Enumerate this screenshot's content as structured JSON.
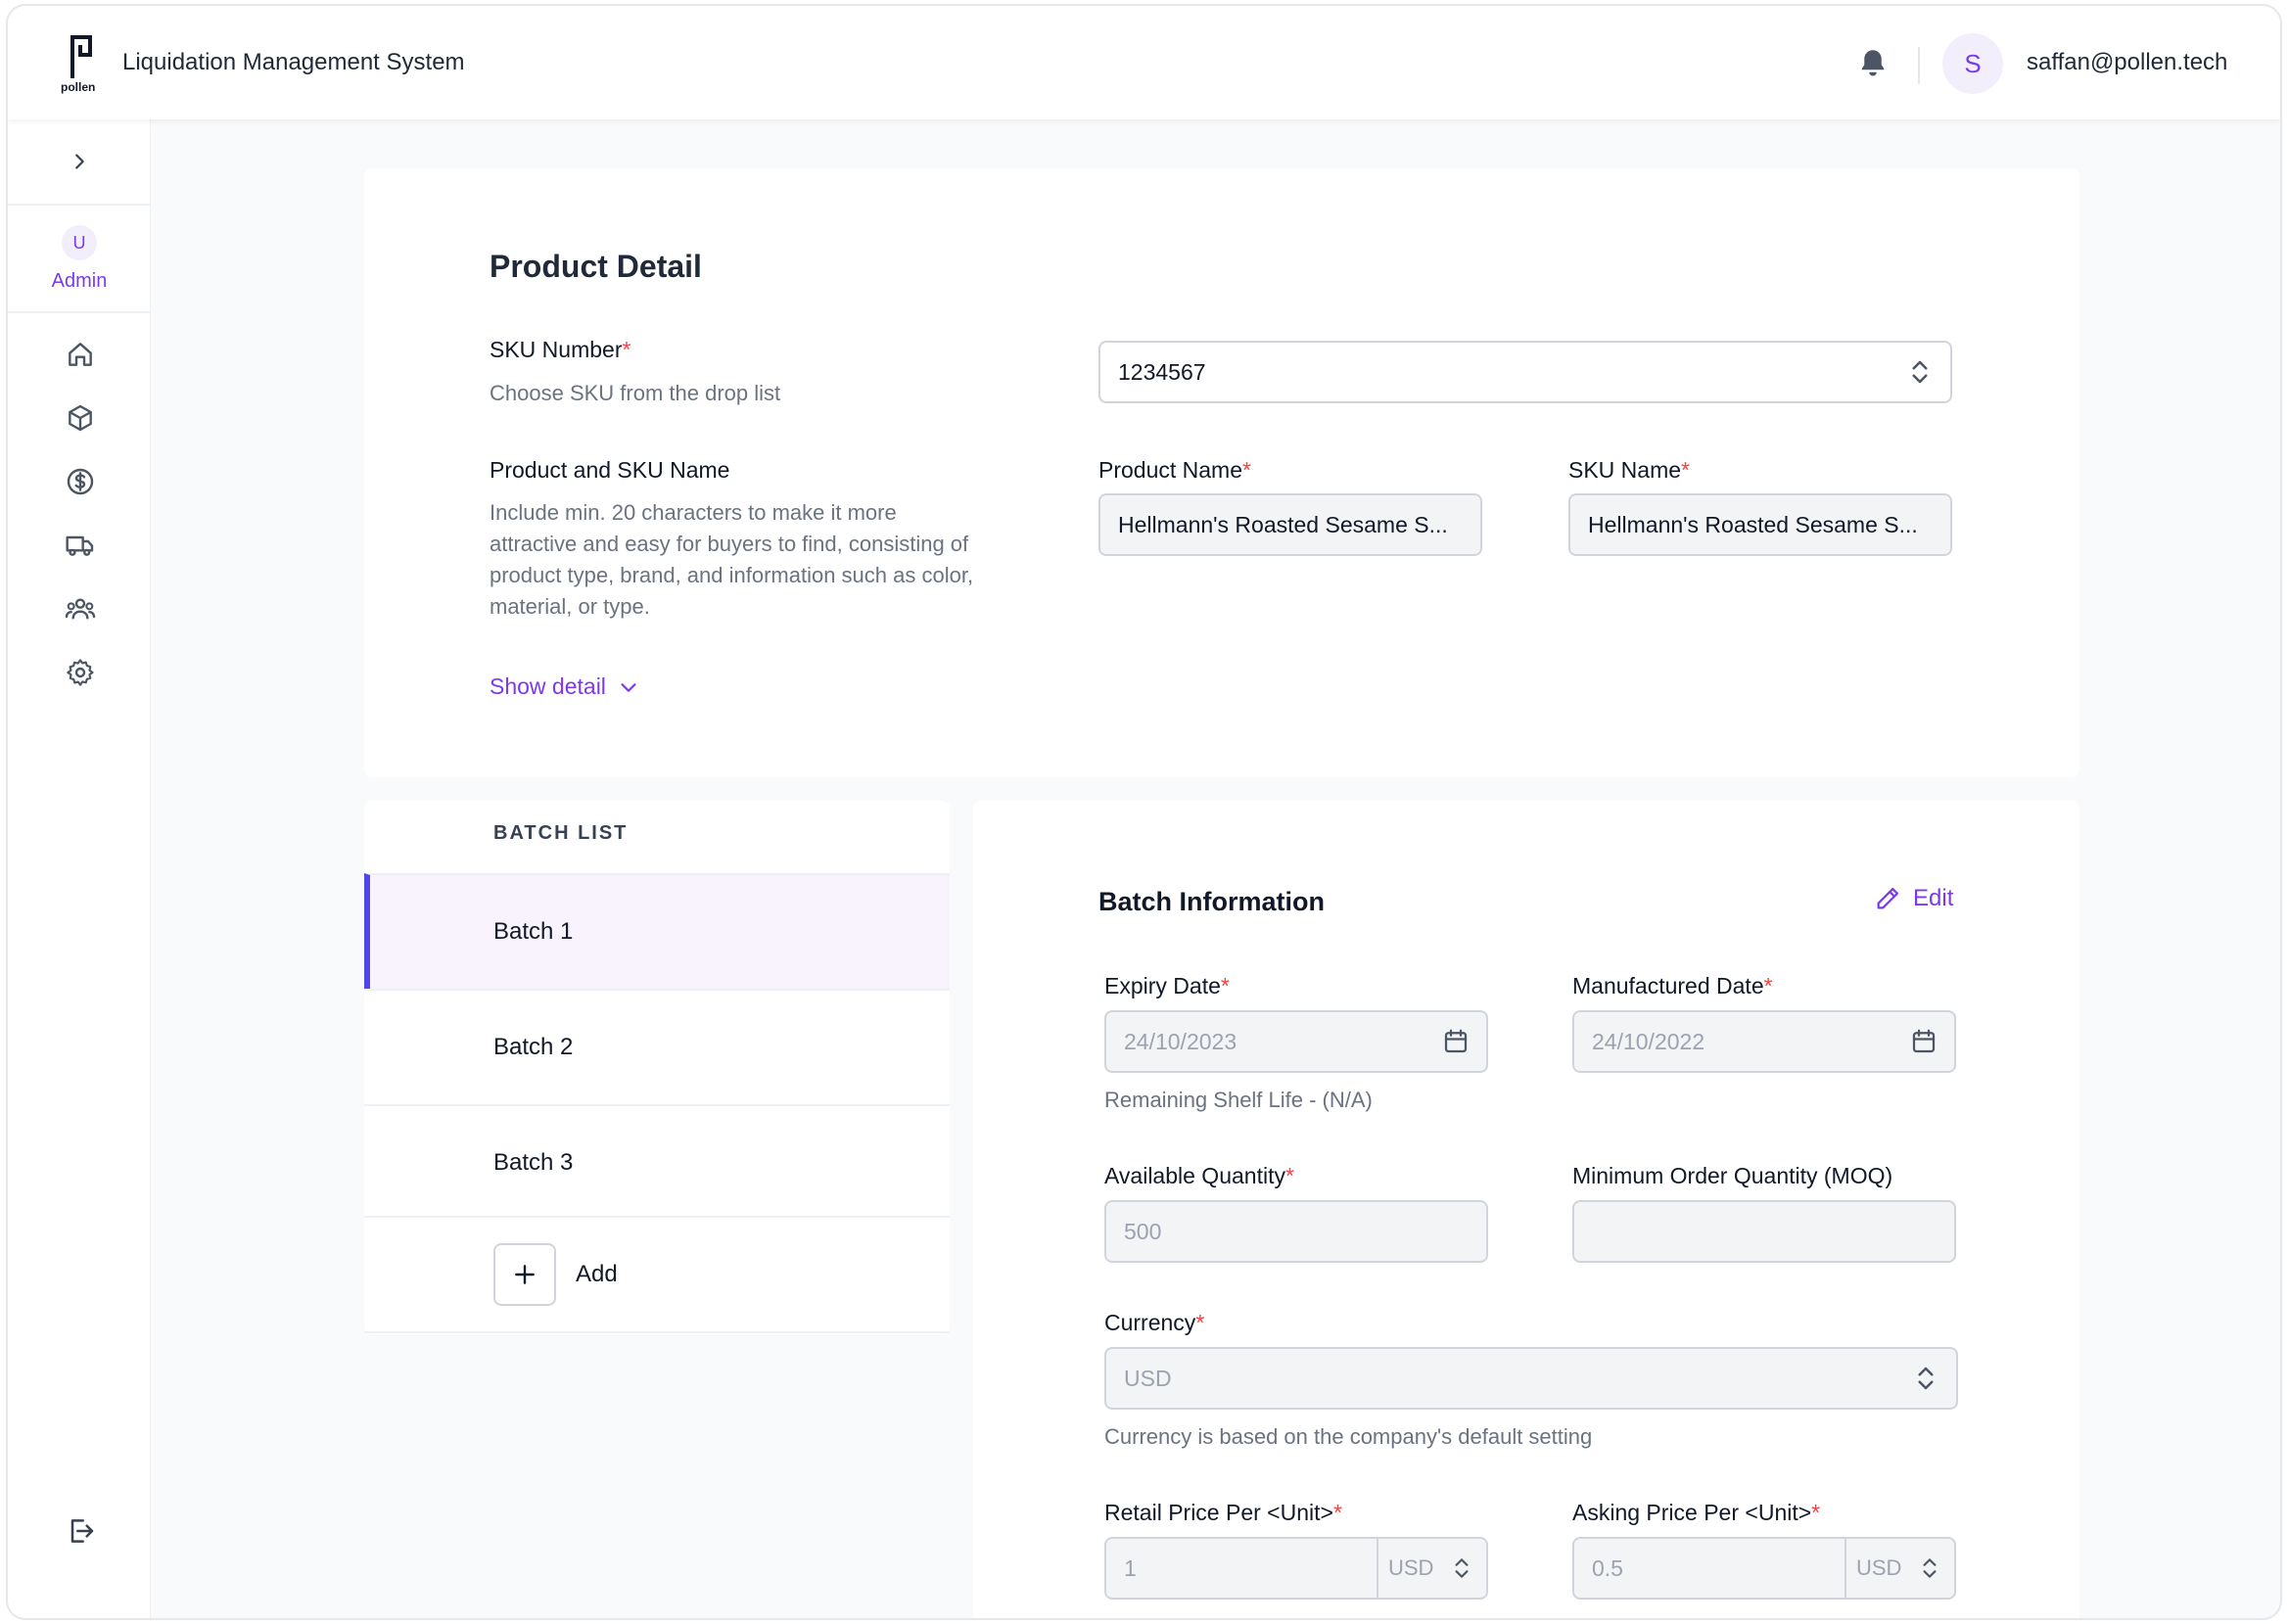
{
  "header": {
    "logo_text": "pollen",
    "app_title": "Liquidation Management System",
    "avatar_initial": "S",
    "user_email": "saffan@pollen.tech"
  },
  "sidebar": {
    "user_initial": "U",
    "role": "Admin",
    "items": [
      {
        "name": "home-icon"
      },
      {
        "name": "box-icon"
      },
      {
        "name": "dollar-icon"
      },
      {
        "name": "truck-icon"
      },
      {
        "name": "users-icon"
      },
      {
        "name": "gear-icon"
      }
    ],
    "logout": "logout-icon"
  },
  "product": {
    "title": "Product Detail",
    "sku_label": "SKU Number",
    "sku_helper": "Choose SKU from the drop list",
    "sku_value": "1234567",
    "name_section_label": "Product and SKU Name",
    "name_section_helper": "Include min. 20 characters to make it more attractive and easy for buyers to find, consisting of product type, brand, and information such as color, material, or type.",
    "product_name_label": "Product Name",
    "product_name_value": "Hellmann's Roasted Sesame S...",
    "sku_name_label": "SKU Name",
    "sku_name_value": "Hellmann's Roasted Sesame S...",
    "show_detail": "Show detail"
  },
  "batch_list": {
    "header": "BATCH LIST",
    "items": [
      "Batch 1",
      "Batch 2",
      "Batch 3"
    ],
    "active_index": 0,
    "add_label": "Add"
  },
  "batch_info": {
    "title": "Batch Information",
    "edit_label": "Edit",
    "expiry_label": "Expiry Date",
    "expiry_value": "24/10/2023",
    "manufactured_label": "Manufactured Date",
    "manufactured_value": "24/10/2022",
    "shelf_life": "Remaining Shelf Life - (N/A)",
    "available_qty_label": "Available Quantity",
    "available_qty_value": "500",
    "moq_label": "Minimum Order Quantity (MOQ)",
    "moq_value": "",
    "currency_label": "Currency",
    "currency_value": "USD",
    "currency_helper": "Currency is based on the company's default setting",
    "retail_price_label": "Retail Price Per <Unit>",
    "retail_price_value": "1",
    "retail_price_currency": "USD",
    "asking_price_label": "Asking Price Per <Unit>",
    "asking_price_value": "0.5",
    "asking_price_currency": "USD"
  },
  "colors": {
    "accent": "#7c3aed",
    "active_bar": "#4f46e5",
    "required": "#ef4444"
  }
}
